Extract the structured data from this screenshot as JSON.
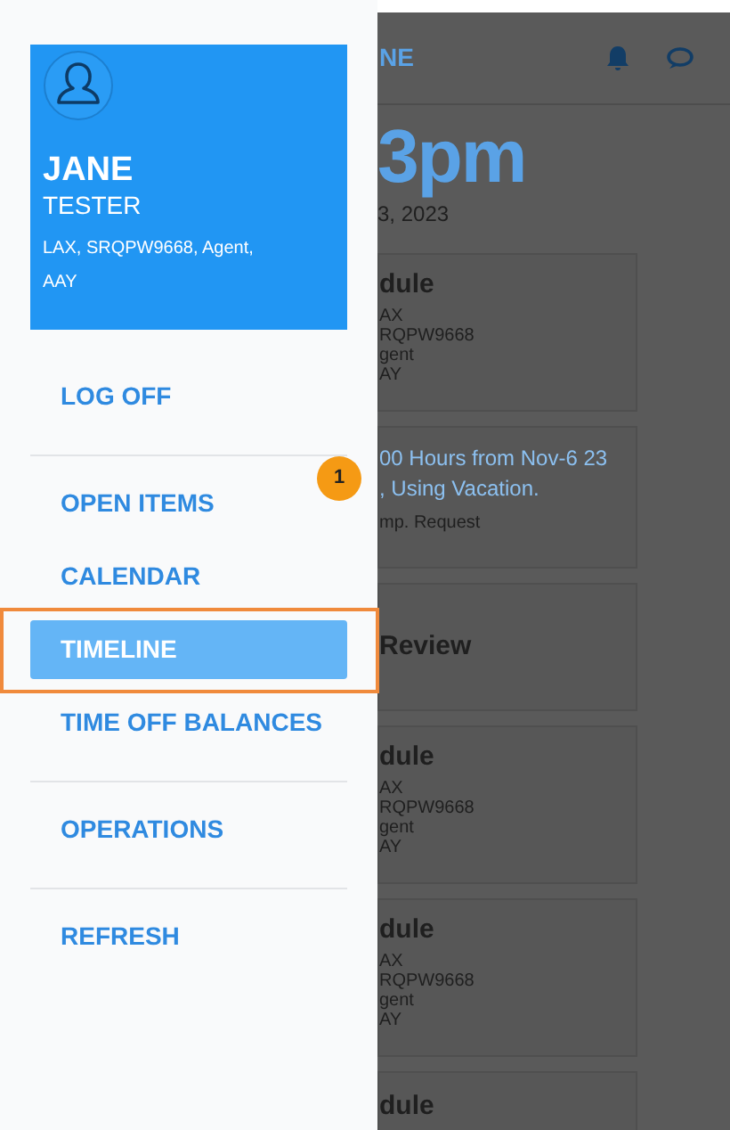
{
  "drawer": {
    "profile": {
      "first_name": "JANE",
      "last_name": "TESTER",
      "details": "LAX, SRQPW9668, Agent, AAY"
    },
    "sections": [
      {
        "items": [
          {
            "label": "LOG OFF",
            "selected": false
          }
        ]
      },
      {
        "items": [
          {
            "label": "OPEN ITEMS",
            "selected": false,
            "badge": "1"
          },
          {
            "label": "CALENDAR",
            "selected": false
          },
          {
            "label": "TIMELINE",
            "selected": true
          },
          {
            "label": "TIME OFF BALANCES",
            "selected": false
          }
        ]
      },
      {
        "items": [
          {
            "label": "OPERATIONS",
            "selected": false
          }
        ]
      },
      {
        "items": [
          {
            "label": "REFRESH",
            "selected": false
          }
        ]
      }
    ]
  },
  "background": {
    "header_title": "NE",
    "time": "3pm",
    "date": "3, 2023",
    "cards": [
      {
        "kind": "schedule",
        "title": "dule",
        "lines": [
          "AX",
          "RQPW9668",
          "gent",
          "AY"
        ]
      },
      {
        "kind": "request",
        "lines": [
          "00 Hours from Nov-6 23",
          ", Using Vacation."
        ],
        "note": "mp. Request"
      },
      {
        "kind": "review",
        "title": "Review"
      },
      {
        "kind": "schedule",
        "title": "dule",
        "lines": [
          "AX",
          "RQPW9668",
          "gent",
          "AY"
        ]
      },
      {
        "kind": "schedule",
        "title": "dule",
        "lines": [
          "AX",
          "RQPW9668",
          "gent",
          "AY"
        ]
      },
      {
        "kind": "partial",
        "title": "dule"
      }
    ]
  }
}
